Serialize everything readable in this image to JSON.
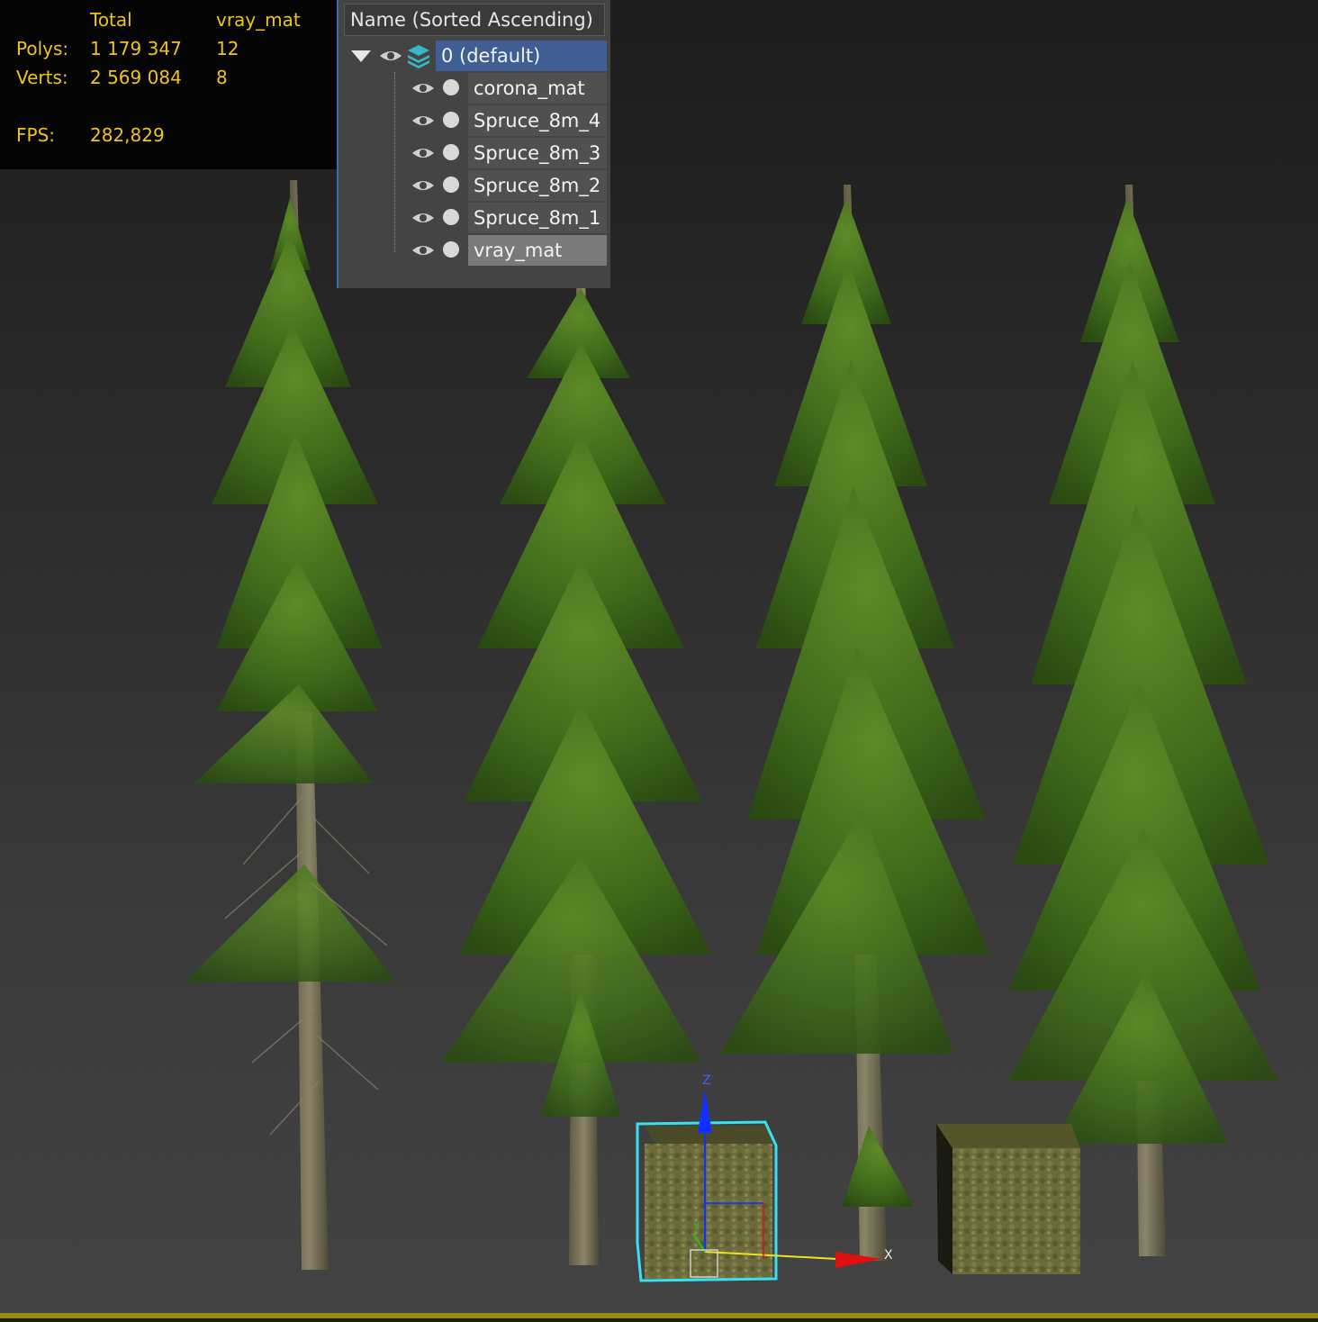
{
  "stats": {
    "col_total": "Total",
    "col_selected": "vray_mat",
    "rows": [
      {
        "label": "Polys:",
        "total": "1 179 347",
        "selected": "12"
      },
      {
        "label": "Verts:",
        "total": "2 569 084",
        "selected": "8"
      }
    ],
    "fps_label": "FPS:",
    "fps_value": "282,829",
    "text_color": "#f0c419"
  },
  "explorer": {
    "header": "Name (Sorted Ascending)",
    "root_layer": "0 (default)",
    "items": [
      "corona_mat",
      "Spruce_8m_4",
      "Spruce_8m_3",
      "Spruce_8m_2",
      "Spruce_8m_1",
      "vray_mat"
    ],
    "selected_item": "vray_mat",
    "accent": "#3b6da6"
  },
  "gizmo": {
    "z_label": "Z",
    "x_label": "X",
    "y_label": "Y"
  },
  "icons": [
    "eye-icon",
    "layer-stack-icon",
    "collapse-triangle-icon",
    "material-dot-icon"
  ]
}
